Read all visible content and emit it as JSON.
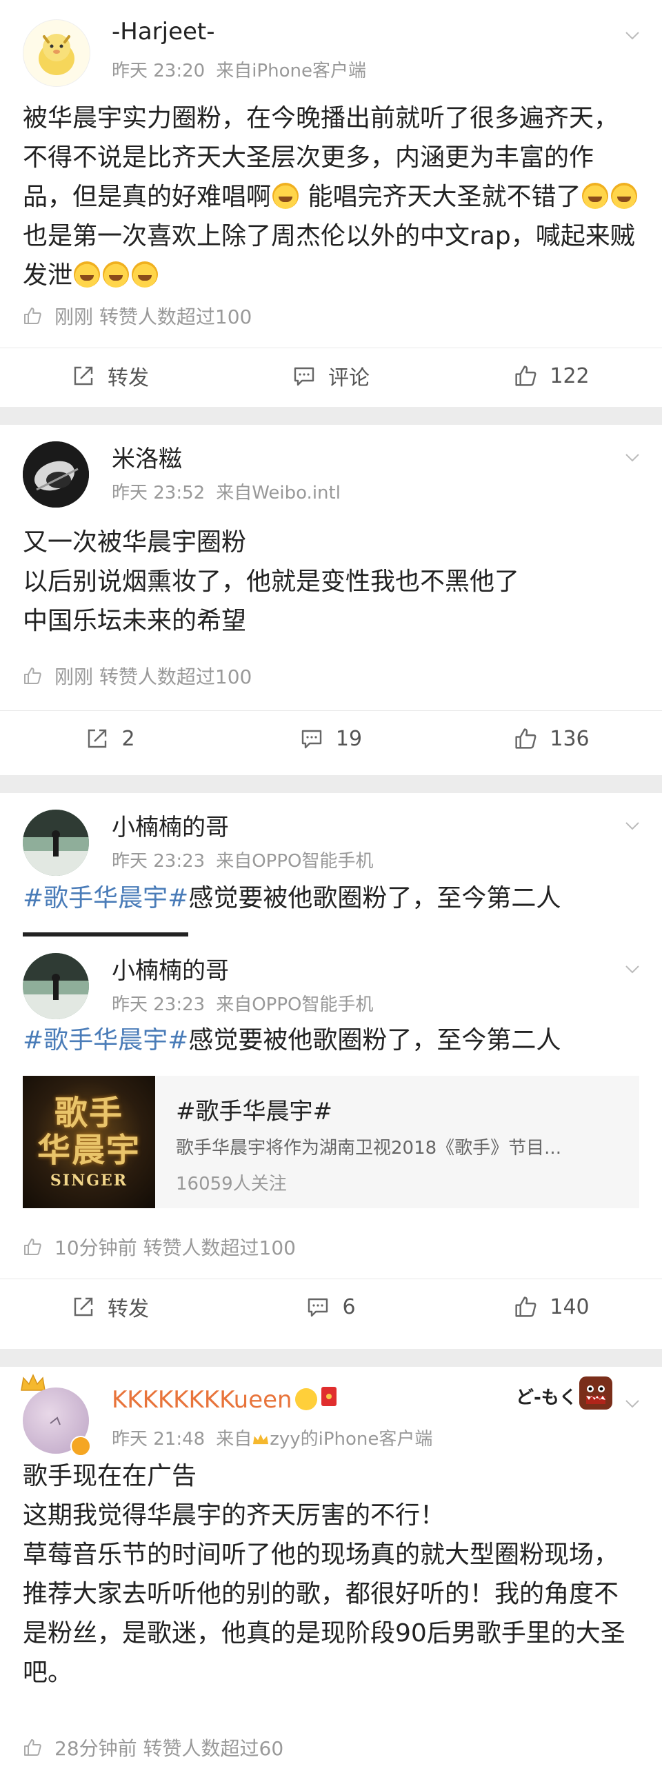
{
  "posts": [
    {
      "username": "-Harjeet-",
      "time": "昨天 23:20",
      "source": "来自iPhone客户端",
      "content": "被华晨宇实力圈粉，在今晚播出前就听了很多遍齐天，不得不说是比齐天大圣层次更多，内涵更为丰富的作品，但是真的好难唱啊",
      "content_2": " 能唱完齐天大圣就不错了",
      "content_3": "也是第一次喜欢上除了周杰伦以外的中文rap，喊起来贼发泄",
      "likes_line": "刚刚 转赞人数超过100",
      "repost_label": "转发",
      "comment_label": "评论",
      "like_count": "122"
    },
    {
      "username": "米洛糍",
      "time": "昨天 23:52",
      "source": "来自Weibo.intl",
      "lines": [
        "又一次被华晨宇圈粉",
        "以后别说烟熏妆了，他就是变性我也不黑他了",
        "中国乐坛未来的希望"
      ],
      "likes_line": "刚刚 转赞人数超过100",
      "repost_count": "2",
      "comment_count": "19",
      "like_count": "136"
    },
    {
      "username": "小楠楠的哥",
      "time": "昨天 23:23",
      "source": "来自OPPO智能手机",
      "hashtag": "#歌手华晨宇#",
      "content": "感觉要被他歌圈粉了，至今第二人"
    },
    {
      "username": "小楠楠的哥",
      "time": "昨天 23:23",
      "source": "来自OPPO智能手机",
      "hashtag": "#歌手华晨宇#",
      "content": "感觉要被他歌圈粉了，至今第二人",
      "topic": {
        "image_big": "歌手",
        "image_big_2": "华晨宇",
        "image_small": "SINGER",
        "title": "#歌手华晨宇#",
        "desc": "歌手华晨宇将作为湖南卫视2018《歌手》节目...",
        "follow": "16059人关注"
      },
      "likes_line": "10分钟前 转赞人数超过100",
      "repost_label": "转发",
      "comment_count": "6",
      "like_count": "140"
    },
    {
      "username": "KKKKKKKKueen",
      "time": "昨天 21:48",
      "source_prefix": "来自",
      "source_rest": "zyy的iPhone客户端",
      "sticker_text": "ど-もく",
      "lines": [
        "歌手现在在广告",
        "这期我觉得华晨宇的齐天厉害的不行！",
        "草莓音乐节的时间听了他的现场真的就大型圈粉现场，推荐大家去听听他的别的歌，都很好听的！我的角度不是粉丝，是歌迷，他真的是现阶段90后男歌手里的大圣吧。"
      ],
      "likes_line": "28分钟前 转赞人数超过60"
    }
  ],
  "colors": {
    "hashtag": "#4a7cb8",
    "vip_name": "#e8743b",
    "meta": "#999999",
    "background": "#ececec"
  },
  "icons": [
    "chevron-down-icon",
    "thumb-up-icon",
    "repost-icon",
    "comment-icon",
    "crown-icon",
    "red-packet-icon"
  ]
}
